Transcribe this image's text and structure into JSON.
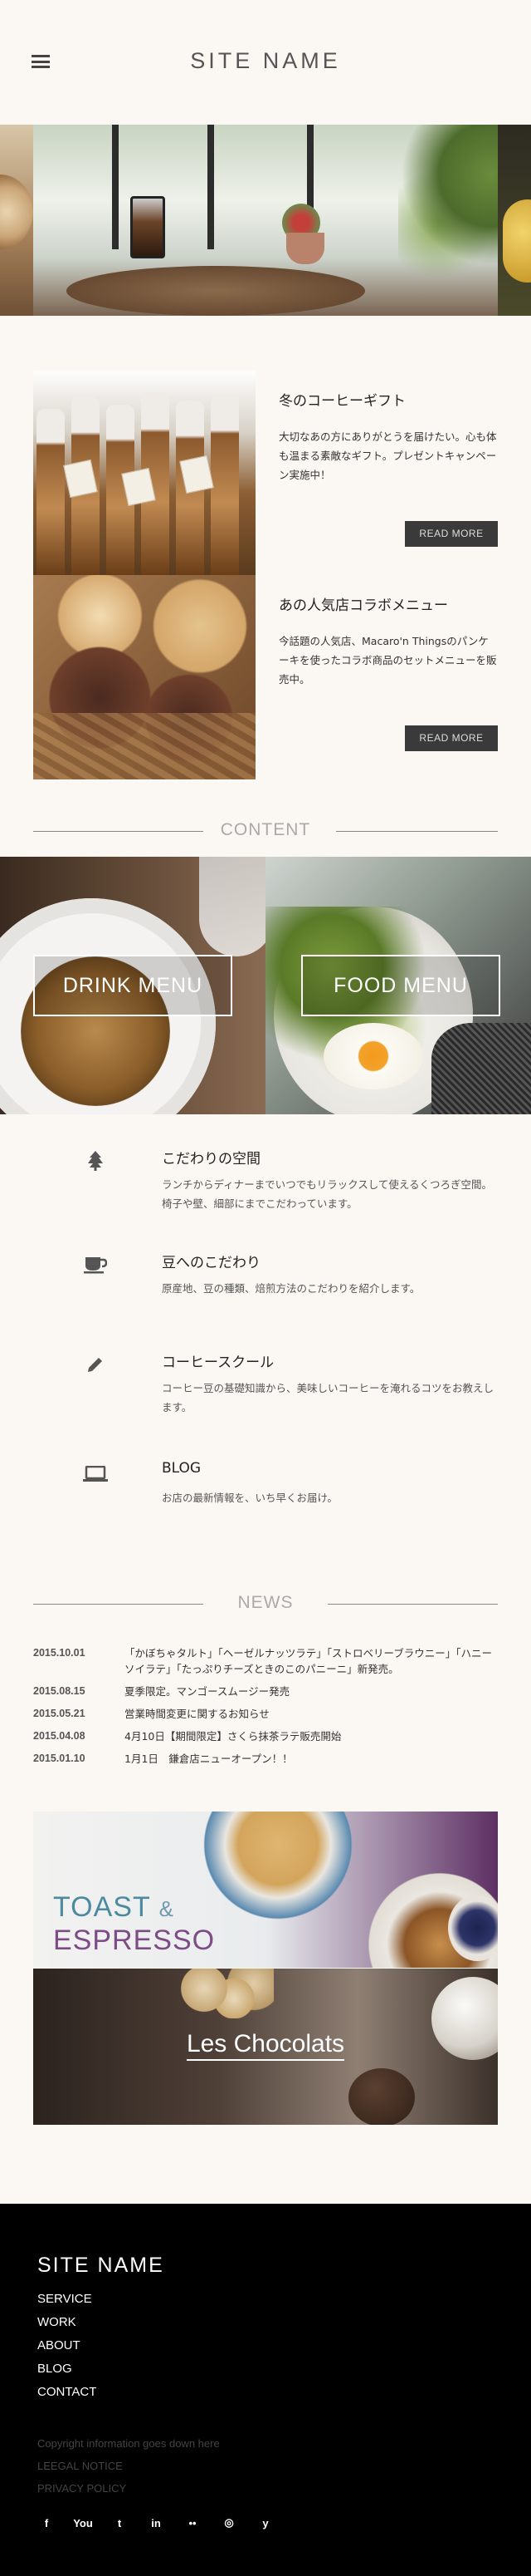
{
  "header": {
    "site_name": "SITE NAME"
  },
  "features": [
    {
      "title": "冬のコーヒーギフト",
      "text": "大切なあの方にありがとうを届けたい。心も体も温まる素敵なギフト。プレゼントキャンペーン実施中！",
      "button": "READ MORE"
    },
    {
      "title": "あの人気店コラボメニュー",
      "text": "今話題の人気店、Macaro'n Thingsのパンケーキを使ったコラボ商品のセットメニューを販売中。",
      "button": "READ MORE"
    }
  ],
  "content": {
    "heading": "CONTENT",
    "drink_label": "DRINK MENU",
    "food_label": "FOOD MENU"
  },
  "features_list": [
    {
      "icon": "tree-icon",
      "title": "こだわりの空間",
      "desc": "ランチからディナーまでいつでもリラックスして使えるくつろぎ空間。椅子や壁、細部にまでこだわっています。"
    },
    {
      "icon": "coffee-cup-icon",
      "title": "豆へのこだわり",
      "desc": "原産地、豆の種類、焙煎方法のこだわりを紹介します。"
    },
    {
      "icon": "pencil-icon",
      "title": "コーヒースクール",
      "desc": "コーヒー豆の基礎知識から、美味しいコーヒーを淹れるコツをお教えします。"
    },
    {
      "icon": "laptop-icon",
      "title": "BLOG",
      "desc": "お店の最新情報を、いち早くお届け。"
    }
  ],
  "news": {
    "heading": "NEWS",
    "items": [
      {
        "date": "2015.10.01",
        "msg": "「かぼちゃタルト」「ヘーゼルナッツラテ」「ストロベリーブラウニー」「ハニーソイラテ」「たっぷりチーズときのこのパニーニ」新発売。"
      },
      {
        "date": "2015.08.15",
        "msg": "夏季限定。マンゴースムージー発売"
      },
      {
        "date": "2015.05.21",
        "msg": "営業時間変更に関するお知らせ"
      },
      {
        "date": "2015.04.08",
        "msg": "4月10日【期間限定】さくら抹茶ラテ販売開始"
      },
      {
        "date": "2015.01.10",
        "msg": "1月1日　鎌倉店ニューオープン！！"
      }
    ]
  },
  "banners": {
    "toast_line1": "TOAST",
    "toast_amp": "&",
    "toast_line2": "ESPRESSO",
    "choco": "Les Chocolats"
  },
  "footer": {
    "site_name": "SITE NAME",
    "nav": [
      "SERVICE",
      "WORK",
      "ABOUT",
      "BLOG",
      "CONTACT"
    ],
    "copyright": "Copyright information goes down here",
    "legal": "LEEGAL NOTICE",
    "privacy": "PRIVACY POLICY",
    "social": [
      {
        "icon": "facebook-icon",
        "glyph": "f"
      },
      {
        "icon": "youtube-icon",
        "glyph": "You"
      },
      {
        "icon": "twitter-icon",
        "glyph": "t"
      },
      {
        "icon": "linkedin-icon",
        "glyph": "in"
      },
      {
        "icon": "flickr-icon",
        "glyph": "••"
      },
      {
        "icon": "instagram-icon",
        "glyph": "◎"
      },
      {
        "icon": "yelp-icon",
        "glyph": "y"
      }
    ]
  },
  "colors": {
    "background": "#fbf8f4",
    "footer": "#000000",
    "button": "#3a3a3a",
    "toast": "#4d8aa0",
    "espresso": "#7d4c86"
  }
}
